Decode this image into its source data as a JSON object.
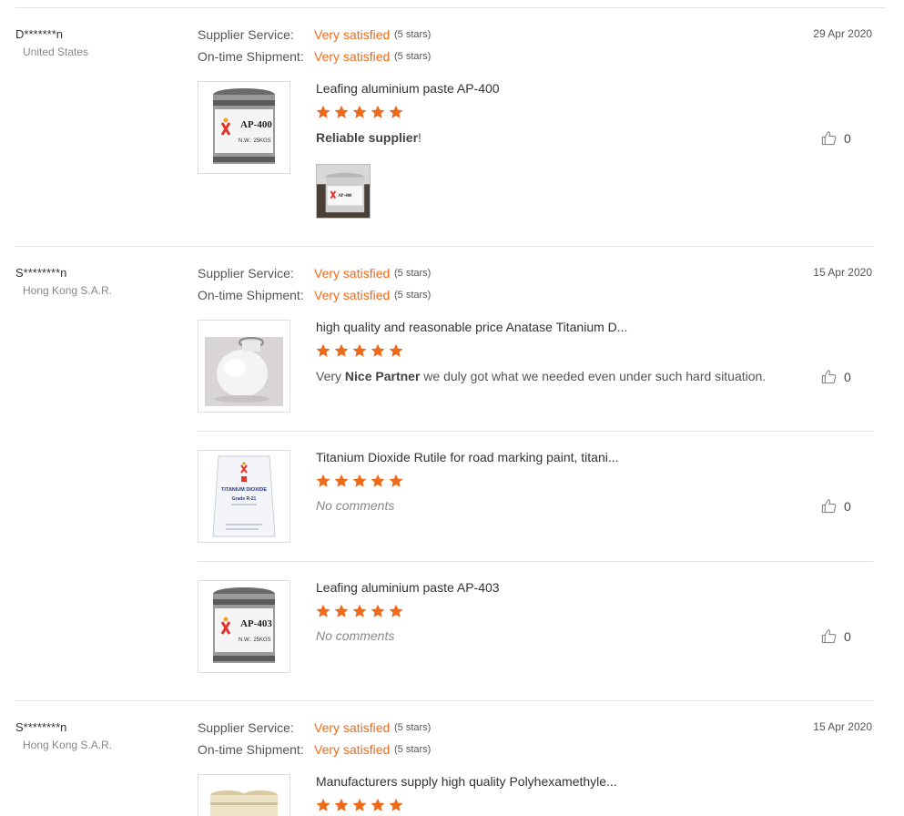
{
  "labels": {
    "supplier_service": "Supplier Service:",
    "ontime_shipment": "On-time Shipment:"
  },
  "colors": {
    "accent": "#ee6a1a",
    "star": "#ee6a1a",
    "separator": "#e3e3e3"
  },
  "reviews": [
    {
      "buyer": "D*******n",
      "country": "United States",
      "date": "29 Apr 2020",
      "supplier_service": {
        "value": "Very satisfied",
        "stars": "(5 stars)"
      },
      "ontime_shipment": {
        "value": "Very satisfied",
        "stars": "(5 stars)"
      },
      "items": [
        {
          "title": "Leafing aluminium paste AP-400",
          "rating": 5,
          "comment_bold": "Reliable supplier",
          "comment_after": "!",
          "likes": "0",
          "thumb_icon": "paint-can-ap400-image",
          "can_label": "AP-400",
          "can_weight": "N.W.: 25KGS",
          "photo_icon": "buyer-photo-image",
          "photo_label": "AP-400"
        }
      ]
    },
    {
      "buyer": "S********n",
      "country": "Hong Kong S.A.R.",
      "date": "15 Apr 2020",
      "supplier_service": {
        "value": "Very satisfied",
        "stars": "(5 stars)"
      },
      "ontime_shipment": {
        "value": "Very satisfied",
        "stars": "(5 stars)"
      },
      "items": [
        {
          "title": "high quality and reasonable price Anatase Titanium D...",
          "rating": 5,
          "comment_before": "Very ",
          "comment_bold": "Nice Partner",
          "comment_after": " we duly got what we needed even under such hard situation.",
          "likes": "0",
          "thumb_icon": "powder-flask-image"
        },
        {
          "title": "Titanium Dioxide Rutile for road marking paint, titani...",
          "rating": 5,
          "comment_empty": "No comments",
          "likes": "0",
          "thumb_icon": "titanium-bag-image",
          "bag_label": "TITANIUM DIOXIDE",
          "bag_grade": "Grade R-21"
        },
        {
          "title": "Leafing aluminium paste AP-403",
          "rating": 5,
          "comment_empty": "No comments",
          "likes": "0",
          "thumb_icon": "paint-can-ap403-image",
          "can_label": "AP-403",
          "can_weight": "N.W.: 25KGS"
        }
      ]
    },
    {
      "buyer": "S********n",
      "country": "Hong Kong S.A.R.",
      "date": "15 Apr 2020",
      "supplier_service": {
        "value": "Very satisfied",
        "stars": "(5 stars)"
      },
      "ontime_shipment": {
        "value": "Very satisfied",
        "stars": "(5 stars)"
      },
      "items": [
        {
          "title": "Manufacturers supply high quality Polyhexamethyle...",
          "rating": 5,
          "thumb_icon": "bottles-image"
        }
      ]
    }
  ]
}
